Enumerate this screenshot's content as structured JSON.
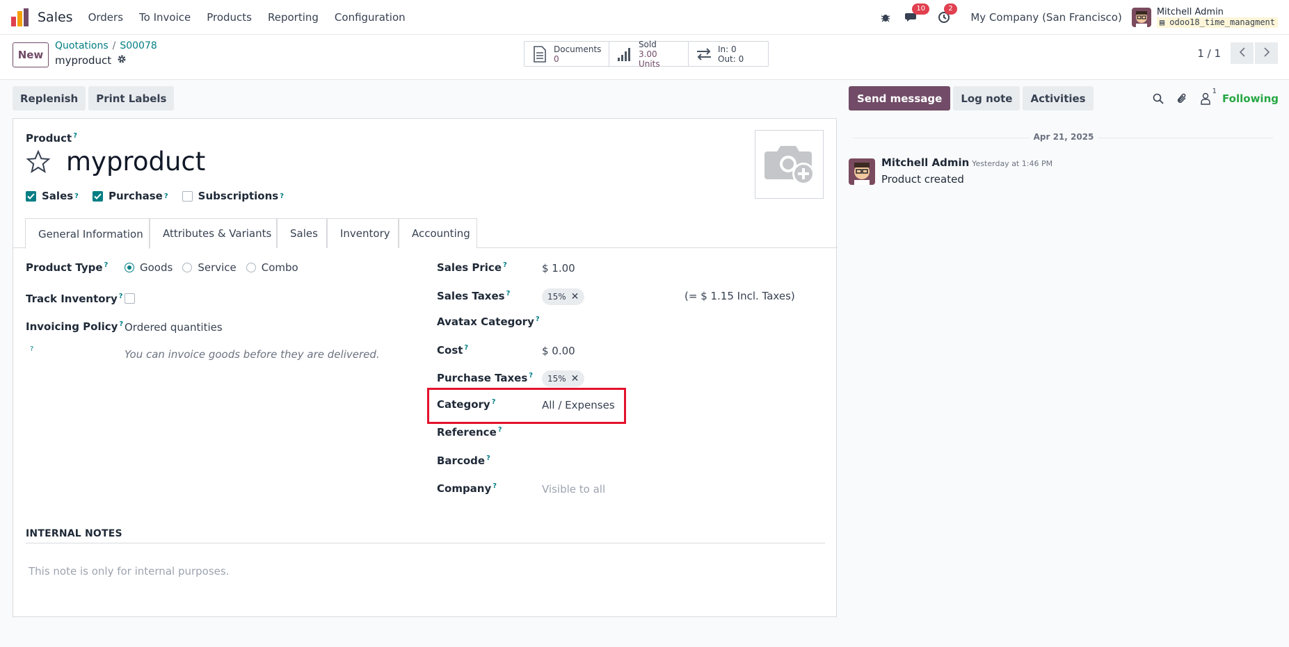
{
  "navbar": {
    "app_name": "Sales",
    "menu": [
      "Orders",
      "To Invoice",
      "Products",
      "Reporting",
      "Configuration"
    ],
    "messages_count": "10",
    "activities_count": "2",
    "company": "My Company (San Francisco)",
    "user_name": "Mitchell Admin",
    "database": "odoo18_time_managment"
  },
  "control": {
    "new_label": "New",
    "breadcrumb_parent": "Quotations",
    "breadcrumb_sep": "/",
    "breadcrumb_current": "S00078",
    "record_name": "myproduct",
    "smart_buttons": {
      "documents_label": "Documents",
      "documents_value": "0",
      "sold_label": "Sold",
      "sold_value": "3.00 Units",
      "in_label": "In: 0",
      "out_label": "Out: 0"
    },
    "pager": "1 / 1"
  },
  "actions": {
    "replenish": "Replenish",
    "print_labels": "Print Labels"
  },
  "form": {
    "product_label": "Product",
    "help_mark": "?",
    "product_name": "myproduct",
    "checkboxes": {
      "sales": {
        "label": "Sales",
        "checked": true
      },
      "purchase": {
        "label": "Purchase",
        "checked": true
      },
      "subscriptions": {
        "label": "Subscriptions",
        "checked": false
      }
    },
    "tabs": [
      "General Information",
      "Attributes & Variants",
      "Sales",
      "Inventory",
      "Accounting"
    ],
    "left": {
      "product_type_label": "Product Type",
      "product_type_options": [
        "Goods",
        "Service",
        "Combo"
      ],
      "product_type_selected": "Goods",
      "track_inventory_label": "Track Inventory",
      "track_inventory": false,
      "invoicing_policy_label": "Invoicing Policy",
      "invoicing_policy_value": "Ordered quantities",
      "invoicing_hint": "You can invoice goods before they are delivered."
    },
    "right": {
      "sales_price_label": "Sales Price",
      "sales_price_value": "$ 1.00",
      "sales_taxes_label": "Sales Taxes",
      "sales_taxes_tag": "15%",
      "sales_taxes_incl": "(= $ 1.15 Incl. Taxes)",
      "avatax_label": "Avatax Category",
      "cost_label": "Cost",
      "cost_value": "$ 0.00",
      "purchase_taxes_label": "Purchase Taxes",
      "purchase_taxes_tag": "15%",
      "category_label": "Category",
      "category_value": "All / Expenses",
      "reference_label": "Reference",
      "barcode_label": "Barcode",
      "company_label": "Company",
      "company_placeholder": "Visible to all"
    },
    "notes_title": "INTERNAL NOTES",
    "notes_placeholder": "This note is only for internal purposes."
  },
  "chatter": {
    "send_message": "Send message",
    "log_note": "Log note",
    "activities": "Activities",
    "followers_count": "1",
    "following": "Following",
    "date": "Apr 21, 2025",
    "author": "Mitchell Admin",
    "time": "Yesterday at 1:46 PM",
    "body": "Product created"
  },
  "colors": {
    "brand": "#714b67",
    "teal": "#017e84",
    "highlight": "#e3122d",
    "following": "#28a745"
  }
}
